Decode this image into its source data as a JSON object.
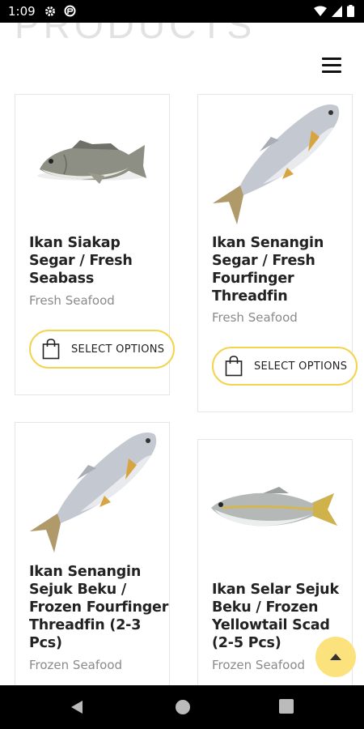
{
  "status": {
    "time": "1:09"
  },
  "page": {
    "heading": "PRODUCTS"
  },
  "products": [
    {
      "title": "Ikan Siakap\nSegar / Fresh\nSeabass",
      "category": "Fresh Seafood",
      "button": "SELECT OPTIONS",
      "image": "seabass-fish"
    },
    {
      "title": "Ikan Senangin\nSegar / Fresh\nFourfinger\nThreadfin",
      "category": "Fresh Seafood",
      "button": "SELECT OPTIONS",
      "image": "threadfin-fish"
    },
    {
      "title": "Ikan Senangin\nSejuk Beku /\nFrozen Fourfinger\nThreadfin (2-3\nPcs)",
      "category": "Frozen Seafood",
      "image": "threadfin-fish"
    },
    {
      "title": "Ikan Selar Sejuk\nBeku / Frozen\nYellowtail Scad\n(2-5 Pcs)",
      "category": "Frozen Seafood",
      "image": "yellowtail-scad-fish"
    }
  ],
  "colors": {
    "accent": "#f2d44e",
    "scroll_button": "#fbe27d"
  },
  "icons": {
    "menu": "hamburger-menu-icon",
    "bag": "shopping-bag-icon",
    "scroll_top": "arrow-up-icon"
  }
}
